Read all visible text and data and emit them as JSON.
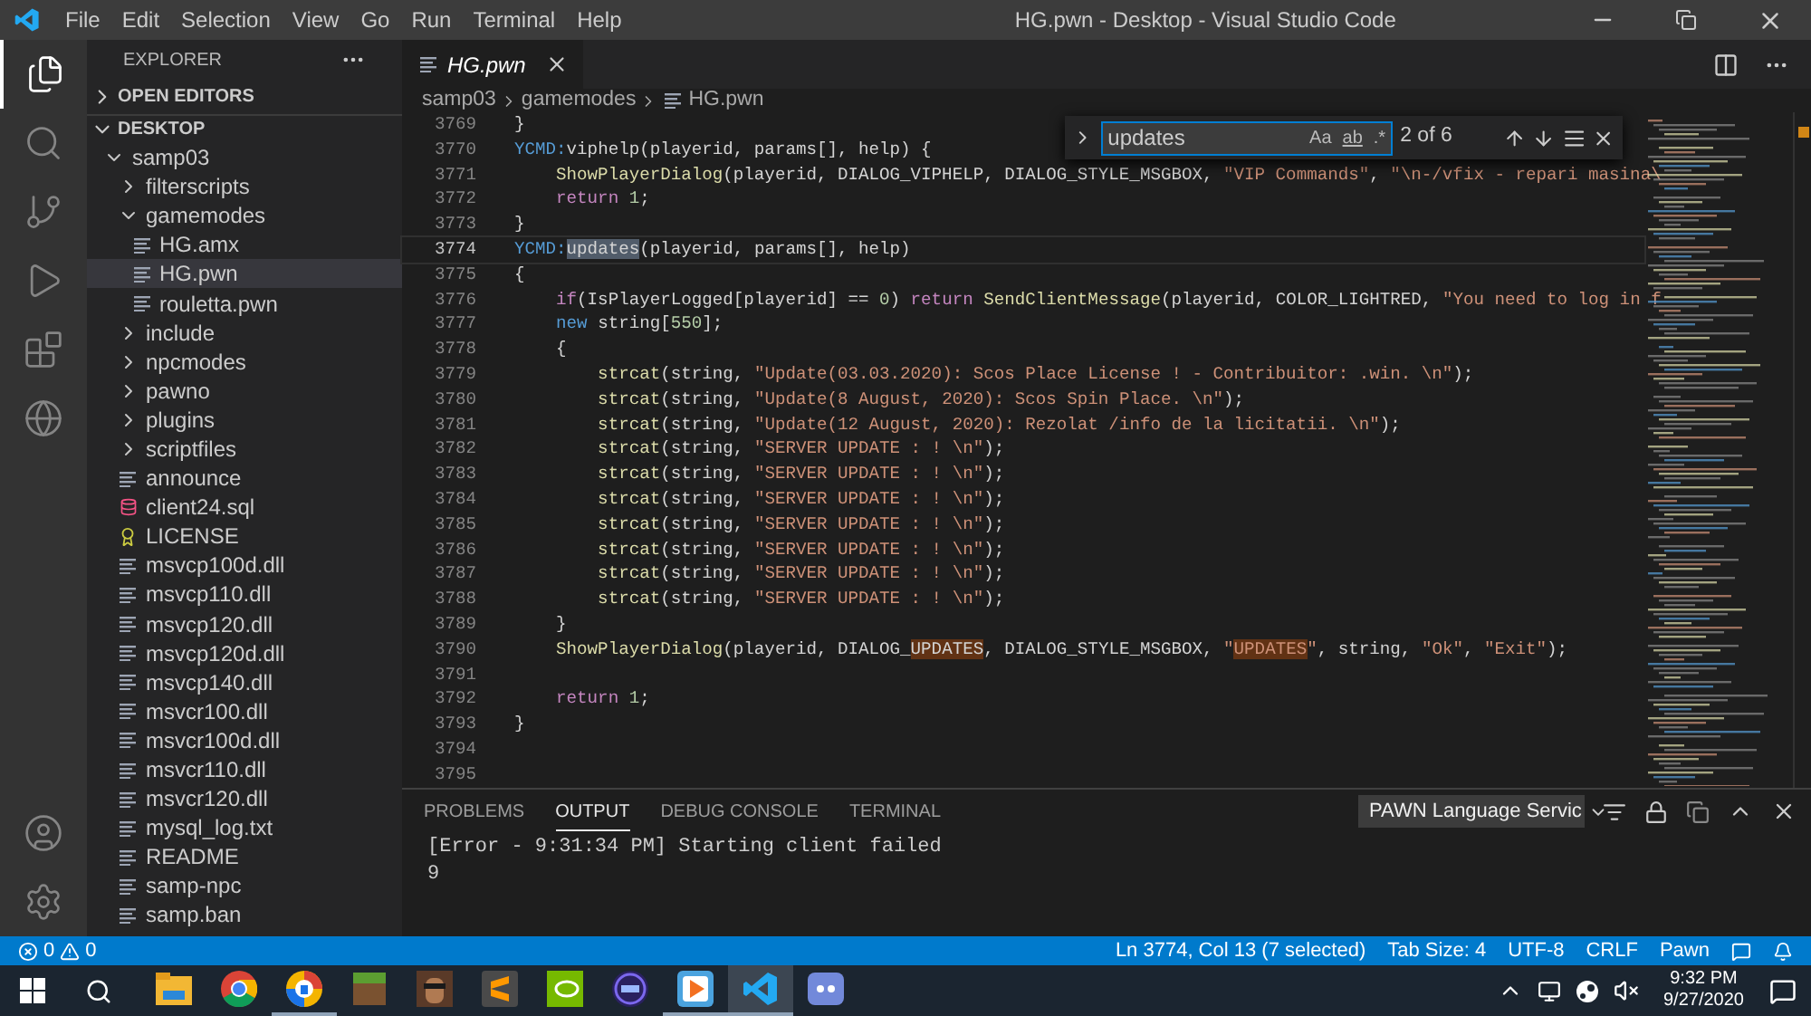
{
  "window": {
    "title": "HG.pwn - Desktop - Visual Studio Code"
  },
  "menu": [
    "File",
    "Edit",
    "Selection",
    "View",
    "Go",
    "Run",
    "Terminal",
    "Help"
  ],
  "activity_bar": [
    {
      "kind": "files",
      "selected": true
    },
    {
      "kind": "search",
      "selected": false
    },
    {
      "kind": "source-control",
      "selected": false
    },
    {
      "kind": "run",
      "selected": false
    },
    {
      "kind": "extensions",
      "selected": false
    },
    {
      "kind": "remote",
      "selected": false
    }
  ],
  "activity_bar_bottom": [
    {
      "kind": "account"
    },
    {
      "kind": "settings"
    }
  ],
  "sidebar": {
    "title": "EXPLORER",
    "sections": [
      {
        "label": "OPEN EDITORS",
        "expanded": false
      },
      {
        "label": "DESKTOP",
        "expanded": true
      }
    ],
    "tree": [
      {
        "label": "samp03",
        "kind": "folder",
        "expanded": true,
        "selected": false,
        "children": [
          {
            "label": "filterscripts",
            "kind": "folder",
            "expanded": false,
            "selected": false
          },
          {
            "label": "gamemodes",
            "kind": "folder",
            "expanded": true,
            "selected": false,
            "children": [
              {
                "label": "HG.amx",
                "kind": "file",
                "selected": false
              },
              {
                "label": "HG.pwn",
                "kind": "file",
                "selected": true
              },
              {
                "label": "rouletta.pwn",
                "kind": "file",
                "selected": false
              }
            ]
          },
          {
            "label": "include",
            "kind": "folder",
            "expanded": false,
            "selected": false
          },
          {
            "label": "npcmodes",
            "kind": "folder",
            "expanded": false,
            "selected": false
          },
          {
            "label": "pawno",
            "kind": "folder",
            "expanded": false,
            "selected": false
          },
          {
            "label": "plugins",
            "kind": "folder",
            "expanded": false,
            "selected": false
          },
          {
            "label": "scriptfiles",
            "kind": "folder",
            "expanded": false,
            "selected": false
          },
          {
            "label": "announce",
            "kind": "file",
            "selected": false
          },
          {
            "label": "client24.sql",
            "kind": "database-file",
            "selected": false
          },
          {
            "label": "LICENSE",
            "kind": "license-file",
            "selected": false
          },
          {
            "label": "msvcp100d.dll",
            "kind": "file",
            "selected": false
          },
          {
            "label": "msvcp110.dll",
            "kind": "file",
            "selected": false
          },
          {
            "label": "msvcp120.dll",
            "kind": "file",
            "selected": false
          },
          {
            "label": "msvcp120d.dll",
            "kind": "file",
            "selected": false
          },
          {
            "label": "msvcp140.dll",
            "kind": "file",
            "selected": false
          },
          {
            "label": "msvcr100.dll",
            "kind": "file",
            "selected": false
          },
          {
            "label": "msvcr100d.dll",
            "kind": "file",
            "selected": false
          },
          {
            "label": "msvcr110.dll",
            "kind": "file",
            "selected": false
          },
          {
            "label": "msvcr120.dll",
            "kind": "file",
            "selected": false
          },
          {
            "label": "mysql_log.txt",
            "kind": "file",
            "selected": false
          },
          {
            "label": "README",
            "kind": "file",
            "selected": false
          },
          {
            "label": "samp-npc",
            "kind": "file",
            "selected": false
          },
          {
            "label": "samp.ban",
            "kind": "file",
            "selected": false
          }
        ]
      }
    ]
  },
  "editor": {
    "tab": {
      "label": "HG.pwn",
      "preview": true
    },
    "breadcrumbs": [
      "samp03",
      "gamemodes",
      "HG.pwn"
    ],
    "find": {
      "value": "updates",
      "options": [
        "Aa",
        "ab",
        ".*"
      ],
      "count": "2 of 6"
    },
    "lines": [
      {
        "number": "3769",
        "current": false,
        "tokens": [
          {
            "t": "}",
            "kind": "plain"
          }
        ]
      },
      {
        "number": "3770",
        "current": false,
        "tokens": [
          {
            "t": "YCMD:",
            "kind": "macro"
          },
          {
            "t": "viphelp(playerid, params[], help) {",
            "kind": "plain"
          }
        ]
      },
      {
        "number": "3771",
        "current": false,
        "tokens": [
          {
            "t": "    ShowPlayerDialog",
            "kind": "func"
          },
          {
            "t": "(playerid, DIALOG_VIPHELP, DIALOG_STYLE_MSGBOX, ",
            "kind": "plain"
          },
          {
            "t": "\"VIP Commands\"",
            "kind": "string"
          },
          {
            "t": ", ",
            "kind": "plain"
          },
          {
            "t": "\"\\n-/vfix - repari masina\\",
            "kind": "string"
          }
        ]
      },
      {
        "number": "3772",
        "current": false,
        "tokens": [
          {
            "t": "    return ",
            "kind": "control"
          },
          {
            "t": "1",
            "kind": "number"
          },
          {
            "t": ";",
            "kind": "plain"
          }
        ]
      },
      {
        "number": "3773",
        "current": false,
        "tokens": [
          {
            "t": "}",
            "kind": "plain"
          }
        ]
      },
      {
        "number": "3774",
        "current": true,
        "tokens": [
          {
            "t": "YCMD:",
            "kind": "macro"
          },
          {
            "t": "updates",
            "kind": "match-current"
          },
          {
            "t": "(playerid, params[], help)",
            "kind": "plain"
          }
        ]
      },
      {
        "number": "3775",
        "current": false,
        "tokens": [
          {
            "t": "{",
            "kind": "plain"
          }
        ]
      },
      {
        "number": "3776",
        "current": false,
        "tokens": [
          {
            "t": "    if",
            "kind": "control"
          },
          {
            "t": "(IsPlayerLogged[playerid] == ",
            "kind": "plain"
          },
          {
            "t": "0",
            "kind": "number"
          },
          {
            "t": ") ",
            "kind": "plain"
          },
          {
            "t": "return ",
            "kind": "control"
          },
          {
            "t": "SendClientMessage",
            "kind": "func"
          },
          {
            "t": "(playerid, COLOR_LIGHTRED, ",
            "kind": "plain"
          },
          {
            "t": "\"You need to log in f",
            "kind": "string"
          }
        ]
      },
      {
        "number": "3777",
        "current": false,
        "tokens": [
          {
            "t": "    new",
            "kind": "keyword"
          },
          {
            "t": " string[",
            "kind": "plain"
          },
          {
            "t": "550",
            "kind": "number"
          },
          {
            "t": "];",
            "kind": "plain"
          }
        ]
      },
      {
        "number": "3778",
        "current": false,
        "tokens": [
          {
            "t": "    {",
            "kind": "plain"
          }
        ]
      },
      {
        "number": "3779",
        "current": false,
        "tokens": [
          {
            "t": "        strcat",
            "kind": "func"
          },
          {
            "t": "(string, ",
            "kind": "plain"
          },
          {
            "t": "\"Update(03.03.2020): Scos Place License ! - Contribuitor: .win. \\n\"",
            "kind": "string"
          },
          {
            "t": ");",
            "kind": "plain"
          }
        ]
      },
      {
        "number": "3780",
        "current": false,
        "tokens": [
          {
            "t": "        strcat",
            "kind": "func"
          },
          {
            "t": "(string, ",
            "kind": "plain"
          },
          {
            "t": "\"Update(8 August, 2020): Scos Spin Place. \\n\"",
            "kind": "string"
          },
          {
            "t": ");",
            "kind": "plain"
          }
        ]
      },
      {
        "number": "3781",
        "current": false,
        "tokens": [
          {
            "t": "        strcat",
            "kind": "func"
          },
          {
            "t": "(string, ",
            "kind": "plain"
          },
          {
            "t": "\"Update(12 August, 2020): Rezolat /info de la licitatii. \\n\"",
            "kind": "string"
          },
          {
            "t": ");",
            "kind": "plain"
          }
        ]
      },
      {
        "number": "3782",
        "current": false,
        "tokens": [
          {
            "t": "        strcat",
            "kind": "func"
          },
          {
            "t": "(string, ",
            "kind": "plain"
          },
          {
            "t": "\"SERVER UPDATE : ! \\n\"",
            "kind": "string"
          },
          {
            "t": ");",
            "kind": "plain"
          }
        ]
      },
      {
        "number": "3783",
        "current": false,
        "tokens": [
          {
            "t": "        strcat",
            "kind": "func"
          },
          {
            "t": "(string, ",
            "kind": "plain"
          },
          {
            "t": "\"SERVER UPDATE : ! \\n\"",
            "kind": "string"
          },
          {
            "t": ");",
            "kind": "plain"
          }
        ]
      },
      {
        "number": "3784",
        "current": false,
        "tokens": [
          {
            "t": "        strcat",
            "kind": "func"
          },
          {
            "t": "(string, ",
            "kind": "plain"
          },
          {
            "t": "\"SERVER UPDATE : ! \\n\"",
            "kind": "string"
          },
          {
            "t": ");",
            "kind": "plain"
          }
        ]
      },
      {
        "number": "3785",
        "current": false,
        "tokens": [
          {
            "t": "        strcat",
            "kind": "func"
          },
          {
            "t": "(string, ",
            "kind": "plain"
          },
          {
            "t": "\"SERVER UPDATE : ! \\n\"",
            "kind": "string"
          },
          {
            "t": ");",
            "kind": "plain"
          }
        ]
      },
      {
        "number": "3786",
        "current": false,
        "tokens": [
          {
            "t": "        strcat",
            "kind": "func"
          },
          {
            "t": "(string, ",
            "kind": "plain"
          },
          {
            "t": "\"SERVER UPDATE : ! \\n\"",
            "kind": "string"
          },
          {
            "t": ");",
            "kind": "plain"
          }
        ]
      },
      {
        "number": "3787",
        "current": false,
        "tokens": [
          {
            "t": "        strcat",
            "kind": "func"
          },
          {
            "t": "(string, ",
            "kind": "plain"
          },
          {
            "t": "\"SERVER UPDATE : ! \\n\"",
            "kind": "string"
          },
          {
            "t": ");",
            "kind": "plain"
          }
        ]
      },
      {
        "number": "3788",
        "current": false,
        "tokens": [
          {
            "t": "        strcat",
            "kind": "func"
          },
          {
            "t": "(string, ",
            "kind": "plain"
          },
          {
            "t": "\"SERVER UPDATE : ! \\n\"",
            "kind": "string"
          },
          {
            "t": ");",
            "kind": "plain"
          }
        ]
      },
      {
        "number": "3789",
        "current": false,
        "tokens": [
          {
            "t": "    }",
            "kind": "plain"
          }
        ]
      },
      {
        "number": "3790",
        "current": false,
        "tokens": [
          {
            "t": "    ShowPlayerDialog",
            "kind": "func"
          },
          {
            "t": "(playerid, DIALOG_",
            "kind": "plain"
          },
          {
            "t": "UPDATES",
            "kind": "match-ident"
          },
          {
            "t": ", DIALOG_STYLE_MSGBOX, ",
            "kind": "plain"
          },
          {
            "t": "\"",
            "kind": "string"
          },
          {
            "t": "UPDATES",
            "kind": "match-string"
          },
          {
            "t": "\"",
            "kind": "string"
          },
          {
            "t": ", string, ",
            "kind": "plain"
          },
          {
            "t": "\"Ok\"",
            "kind": "string"
          },
          {
            "t": ", ",
            "kind": "plain"
          },
          {
            "t": "\"Exit\"",
            "kind": "string"
          },
          {
            "t": ");",
            "kind": "plain"
          }
        ]
      },
      {
        "number": "3791",
        "current": false
      },
      {
        "number": "3792",
        "current": false,
        "tokens": [
          {
            "t": "    return ",
            "kind": "control"
          },
          {
            "t": "1",
            "kind": "number"
          },
          {
            "t": ";",
            "kind": "plain"
          }
        ]
      },
      {
        "number": "3793",
        "current": false,
        "tokens": [
          {
            "t": "}",
            "kind": "plain"
          }
        ]
      },
      {
        "number": "3794",
        "current": false
      },
      {
        "number": "3795",
        "current": false
      }
    ]
  },
  "panel": {
    "tabs": [
      {
        "label": "PROBLEMS",
        "selected": false
      },
      {
        "label": "OUTPUT",
        "selected": true
      },
      {
        "label": "DEBUG CONSOLE",
        "selected": false
      },
      {
        "label": "TERMINAL",
        "selected": false
      }
    ],
    "channel": "PAWN Language Servic",
    "output": [
      "[Error - 9:31:34 PM] Starting client failed",
      "9"
    ]
  },
  "status_bar": {
    "errors": "0",
    "warnings": "0",
    "right": [
      "Ln 3774, Col 13 (7 selected)",
      "Tab Size: 4",
      "UTF-8",
      "CRLF",
      "Pawn"
    ]
  },
  "taskbar": {
    "apps": [
      {
        "kind": "file-explorer",
        "selected": false,
        "running": false
      },
      {
        "kind": "chrome",
        "selected": false,
        "running": false
      },
      {
        "kind": "browser",
        "selected": false,
        "running": true
      },
      {
        "kind": "grass-block",
        "selected": false,
        "running": false
      },
      {
        "kind": "game",
        "selected": false,
        "running": false
      },
      {
        "kind": "sublime",
        "selected": false,
        "running": false
      },
      {
        "kind": "nvidia",
        "selected": false,
        "running": false
      },
      {
        "kind": "launcher",
        "selected": false,
        "running": false
      },
      {
        "kind": "media-player",
        "selected": false,
        "running": true
      },
      {
        "kind": "vscode",
        "selected": true,
        "running": true
      },
      {
        "kind": "discord",
        "selected": false,
        "running": false
      }
    ],
    "time": "9:32 PM",
    "date": "9/27/2020"
  }
}
